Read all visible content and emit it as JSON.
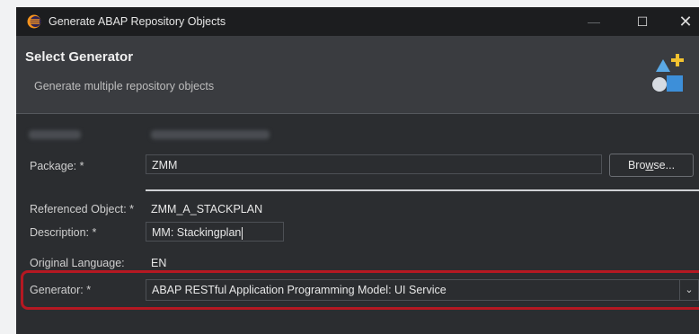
{
  "window": {
    "title": "Generate ABAP Repository Objects",
    "minimize": "—",
    "maximize": "☐",
    "close": "✕"
  },
  "header": {
    "title": "Select Generator",
    "subtitle": "Generate multiple repository objects"
  },
  "form": {
    "package_label": "Package: *",
    "package_value": "ZMM",
    "browse_prefix": "Bro",
    "browse_mnemonic": "w",
    "browse_suffix": "se...",
    "referenced_object_label": "Referenced Object: *",
    "referenced_object_value": "ZMM_A_STACKPLAN",
    "description_label": "Description: *",
    "description_value": "MM: Stackingplan",
    "original_language_label": "Original Language:",
    "original_language_value": "EN",
    "generator_label": "Generator: *",
    "generator_value": "ABAP RESTful Application Programming Model: UI Service"
  },
  "colors": {
    "highlight_border": "#b51822",
    "window_bg": "#2b2d30",
    "header_bg": "#3a3c40"
  },
  "icons": {
    "app": "eclipse-icon",
    "wizard": "new-objects-wizard-icon",
    "dropdown": "chevron-down-icon"
  }
}
